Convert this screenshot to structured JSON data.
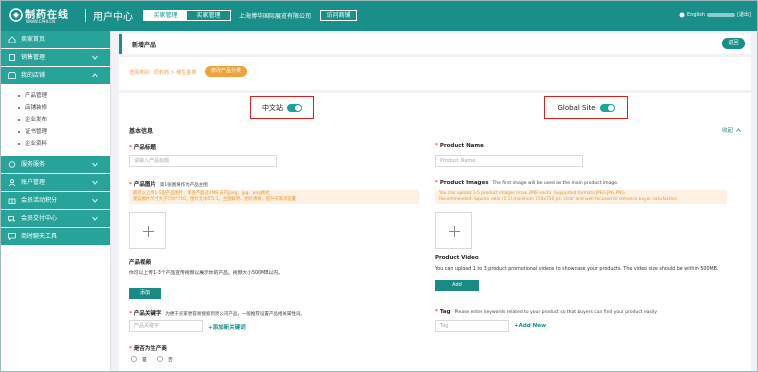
{
  "header": {
    "logo_text": "制药在线",
    "logo_sub": "WWW.CPHI.CN",
    "center_title": "用户中心",
    "role_tabs": [
      {
        "label": "买家管理",
        "active": true
      },
      {
        "label": "买家管理",
        "active": false
      }
    ],
    "company": "上海博华国际展览有限公司",
    "visit_btn": "访问商铺",
    "language": "English",
    "logout": "[退出]"
  },
  "sidebar": {
    "items": [
      {
        "label": "卖家首页"
      },
      {
        "label": "销售管理"
      },
      {
        "label": "我的店铺",
        "expanded": true
      },
      {
        "label": "服务服务"
      },
      {
        "label": "账户管理"
      },
      {
        "label": "会员活动积分"
      },
      {
        "label": "会员交付中心"
      },
      {
        "label": "商时聊天工具"
      }
    ],
    "submenu": [
      "产品管理",
      "店铺装修",
      "企业发布",
      "证书管理",
      "企业资料"
    ]
  },
  "page": {
    "title": "新增产品",
    "back_btn": "返回",
    "crumb": "选择类别：原料药 > 维生素类",
    "cat_btn": "修改产品分类"
  },
  "form": {
    "cn_site_label": "中文站",
    "global_site_label": "Global Site",
    "section_title": "基本信息",
    "collapse": "收起",
    "cn": {
      "name_label": "产品标题",
      "name_placeholder": "请输入产品标题",
      "images_label": "产品图片",
      "images_hint": "第1张图将作为产品主图",
      "images_warn_1": "最可以上传1-5张产品图片，单张不超过2MB,支持jpeg、jpg、png格式",
      "images_warn_2": "建议图片尺寸大于750*750，图片无水印1:1，主图鲜明、图片清晰，提升买家浏览量",
      "video_label": "产品视频",
      "video_desc": "你可以上传1-3个产品宣传视频以展示你的产品。视频大小500MB以内。",
      "video_btn": "添加",
      "keyword_label": "产品关键字",
      "keyword_hint": "为便于买家更容易搜索到贵公司产品，一般推荐设置产品相关属性词。",
      "keyword_placeholder": "产品关键字",
      "keyword_add": "+添加新关键词",
      "producer_label": "是否为生产商",
      "opt_yes": "是",
      "opt_no": "否"
    },
    "en": {
      "name_label": "Product Name",
      "name_placeholder": "Product Name",
      "images_label": "Product Images",
      "images_hint": "The first image will be used as the main product image.",
      "images_warn_1": "You can upload 1-5 product images (max 2MB each). Supported formats:JPEG,JPG,PNG.",
      "images_warn_2": "Recommended: Square ratio (1:1),minimum 750x750 px, clear and well-focused to enhance buyer satisfaction.",
      "video_label": "Product Video",
      "video_desc": "You can upload 1 to 3 product promotional videos to showcase your products. The video size should be within 500MB.",
      "video_btn": "Add",
      "tag_label": "Tag",
      "tag_hint": "Please enter keywords related to your product so that buyers can find your product easily",
      "tag_placeholder": "Tag",
      "tag_add": "+Add New"
    }
  },
  "colors": {
    "brand": "#1a8f8a",
    "sidebar": "#27a39a",
    "warn": "#e8962f",
    "highlight": "#e02020"
  }
}
